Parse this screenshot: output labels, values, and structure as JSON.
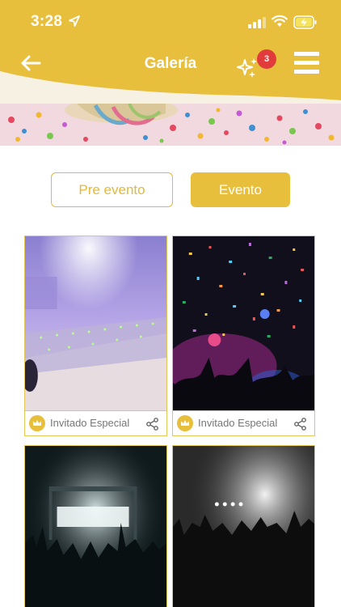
{
  "status_bar": {
    "time": "3:28"
  },
  "header": {
    "title": "Galería",
    "notification_count": "3",
    "back_icon": "arrow-left-icon",
    "sparkle_icon": "sparkles-icon",
    "menu_icon": "hamburger-menu-icon"
  },
  "tabs": [
    {
      "label": "Pre evento",
      "active": false
    },
    {
      "label": "Evento",
      "active": true
    }
  ],
  "gallery": {
    "items": [
      {
        "author": "Invitado Especial",
        "badge_icon": "crown-icon",
        "share_icon": "share-icon"
      },
      {
        "author": "Invitado Especial",
        "badge_icon": "crown-icon",
        "share_icon": "share-icon"
      },
      {
        "author": "",
        "badge_icon": "",
        "share_icon": ""
      },
      {
        "author": "",
        "badge_icon": "",
        "share_icon": ""
      }
    ]
  },
  "colors": {
    "brand": "#e8bf3c",
    "badge": "#e23b3b",
    "card_border": "#e7c556",
    "muted_text": "#777777"
  }
}
